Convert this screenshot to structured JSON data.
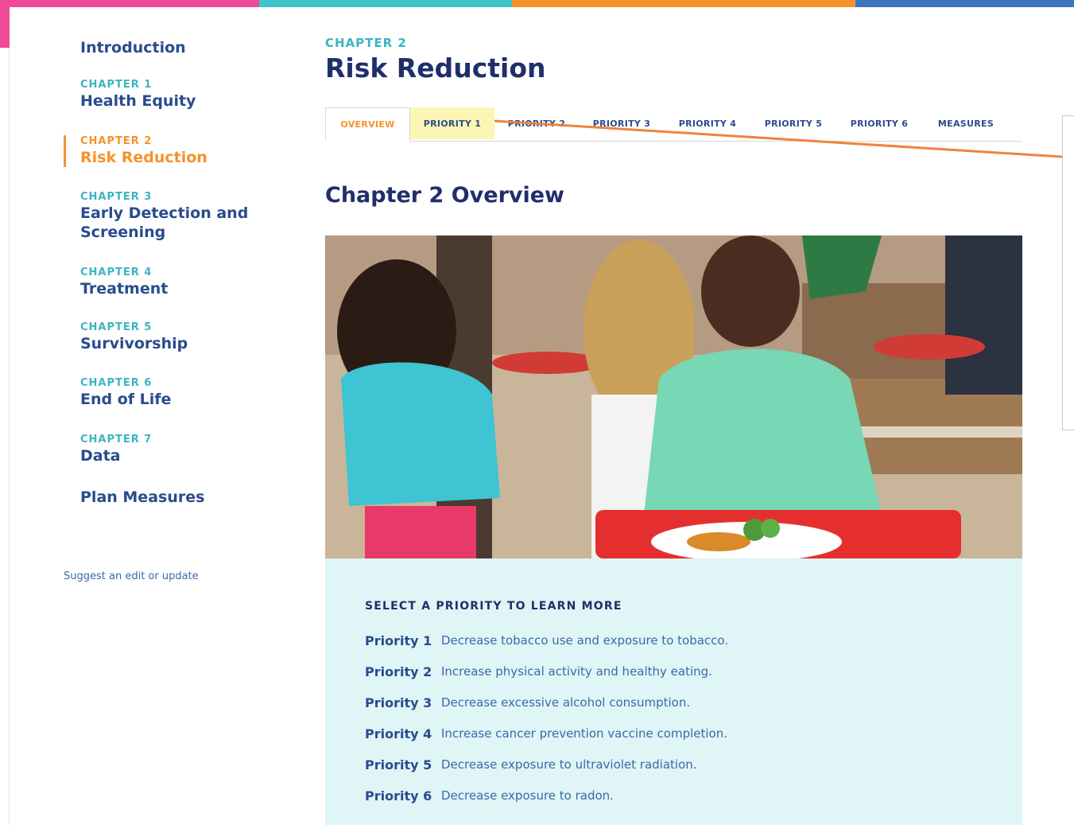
{
  "colors": {
    "topbar": [
      "#ef4b96",
      "#3ec4c9",
      "#f5922b",
      "#3e75bc"
    ],
    "accent": "#f5922b",
    "teal": "#3ab5c0",
    "navy": "#1f2f6b",
    "link": "#2a4b8d",
    "panel_bg": "#dff5f6",
    "annotation_arrow": "#f0833a"
  },
  "sidebar": {
    "items": [
      {
        "kicker": "",
        "title": "Introduction"
      },
      {
        "kicker": "CHAPTER 1",
        "title": "Health Equity"
      },
      {
        "kicker": "CHAPTER 2",
        "title": "Risk Reduction"
      },
      {
        "kicker": "CHAPTER 3",
        "title": "Early Detection and Screening"
      },
      {
        "kicker": "CHAPTER 4",
        "title": "Treatment"
      },
      {
        "kicker": "CHAPTER 5",
        "title": "Survivorship"
      },
      {
        "kicker": "CHAPTER 6",
        "title": "End of Life"
      },
      {
        "kicker": "CHAPTER 7",
        "title": "Data"
      },
      {
        "kicker": "",
        "title": "Plan Measures"
      }
    ],
    "suggest_link": "Suggest an edit or update"
  },
  "header": {
    "kicker": "CHAPTER 2",
    "title": "Risk Reduction"
  },
  "tabs": [
    "OVERVIEW",
    "PRIORITY 1",
    "PRIORITY 2",
    "PRIORITY 3",
    "PRIORITY 4",
    "PRIORITY 5",
    "PRIORITY 6",
    "MEASURES"
  ],
  "section_title": "Chapter 2 Overview",
  "hero_image": {
    "icon": "photo-children-cafeteria"
  },
  "priorities": {
    "heading": "SELECT A PRIORITY TO LEARN MORE",
    "items": [
      {
        "label": "Priority 1",
        "desc": "Decrease tobacco use and exposure to tobacco."
      },
      {
        "label": "Priority 2",
        "desc": "Increase physical activity and healthy eating."
      },
      {
        "label": "Priority 3",
        "desc": "Decrease excessive alcohol consumption."
      },
      {
        "label": "Priority 4",
        "desc": "Increase cancer prevention vaccine completion."
      },
      {
        "label": "Priority 5",
        "desc": "Decrease exposure to ultraviolet radiation."
      },
      {
        "label": "Priority 6",
        "desc": "Decrease exposure to radon."
      }
    ]
  }
}
